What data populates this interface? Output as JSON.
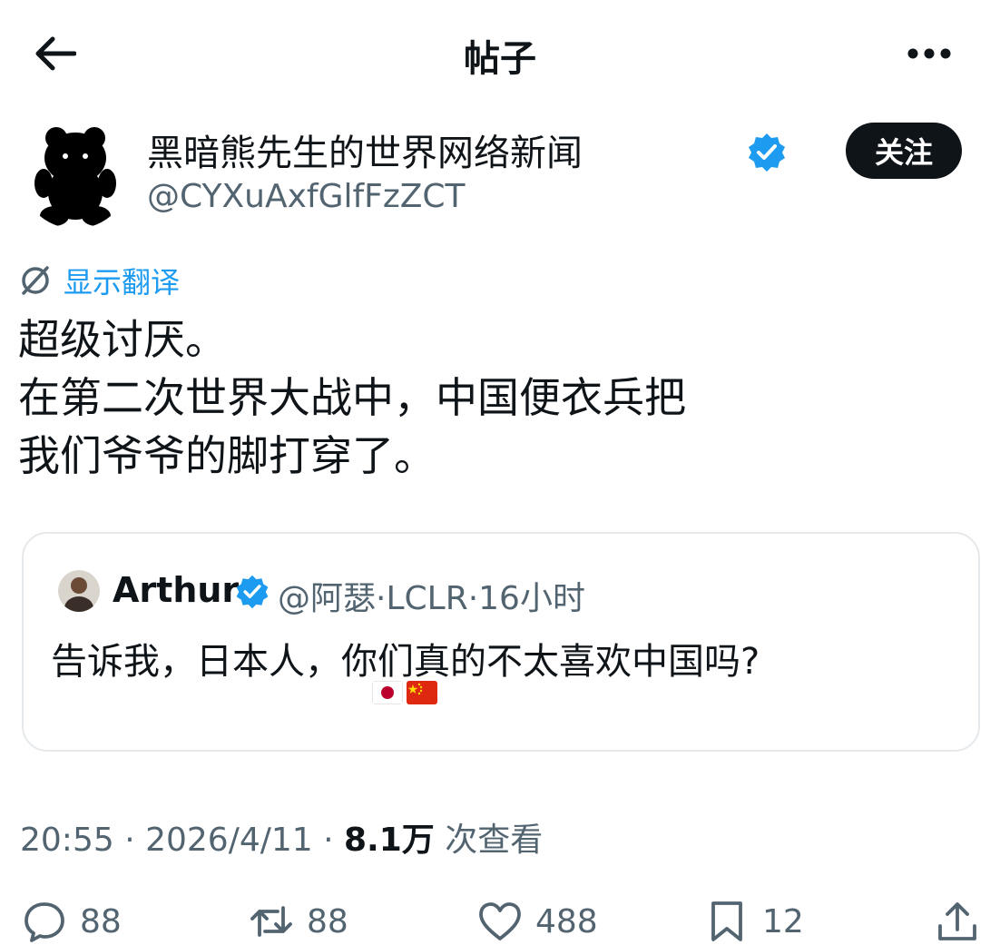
{
  "header": {
    "title": "帖子",
    "back_icon": "arrow-left-icon",
    "more_icon": "more-horizontal-icon"
  },
  "author": {
    "name": "黑暗熊先生的世界网络新闻",
    "handle": "@CYXuAxfGlfFzZCT",
    "verified": true,
    "follow_label": "关注"
  },
  "translate_label": "显示翻译",
  "post": {
    "lines": [
      "超级讨厌。",
      "在第二次世界大战中，中国便衣兵把",
      "我们爷爷的脚打穿了。"
    ]
  },
  "quote": {
    "name": "Arthur",
    "meta": "@阿瑟·LCLR·16小时",
    "text": "告诉我，日本人，你们真的不太喜欢中国吗?",
    "flags": [
      "japan-flag",
      "china-flag"
    ]
  },
  "timestamp": {
    "time": "20:55 · 2026/4/11 · ",
    "views": "8.1万",
    "views_label": " 次查看"
  },
  "actions": {
    "reply": "88",
    "retweet": "88",
    "like": "488",
    "bookmark": "12"
  },
  "colors": {
    "accent": "#1d9bf0",
    "text": "#0f1419",
    "secondary": "#536471",
    "border": "#e6e9ec"
  }
}
